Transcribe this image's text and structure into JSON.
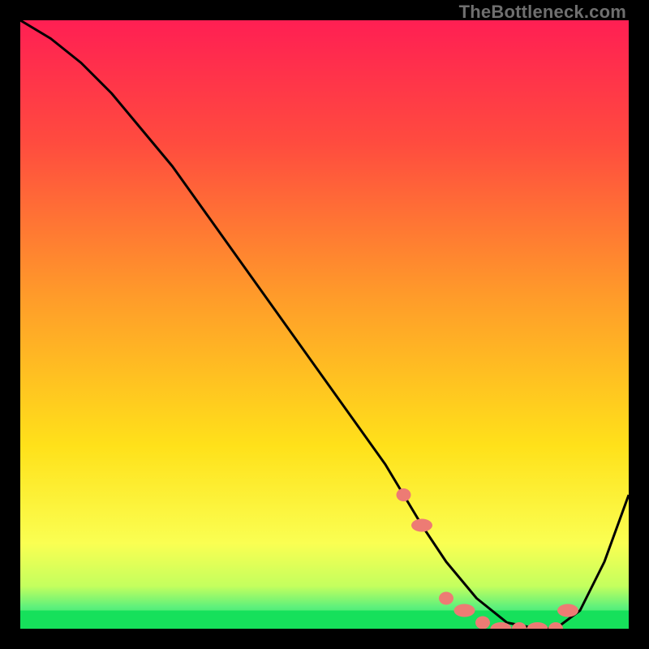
{
  "watermark": "TheBottleneck.com",
  "colors": {
    "curve": "#000000",
    "dots": "#ed7b74",
    "green_band": "#16e05b",
    "frame_bg": "#000000"
  },
  "chart_data": {
    "type": "line",
    "title": "",
    "xlabel": "",
    "ylabel": "",
    "xlim": [
      0,
      100
    ],
    "ylim": [
      0,
      100
    ],
    "grid": false,
    "legend": false,
    "series": [
      {
        "name": "bottleneck-curve",
        "x": [
          0,
          5,
          10,
          15,
          20,
          25,
          30,
          35,
          40,
          45,
          50,
          55,
          60,
          63,
          66,
          70,
          75,
          80,
          85,
          88,
          92,
          96,
          100
        ],
        "y": [
          100,
          97,
          93,
          88,
          82,
          76,
          69,
          62,
          55,
          48,
          41,
          34,
          27,
          22,
          17,
          11,
          5,
          1,
          0,
          0,
          3,
          11,
          22
        ]
      }
    ],
    "highlight_points": {
      "name": "optimal-range-dots",
      "x": [
        63,
        66,
        70,
        73,
        76,
        79,
        82,
        85,
        88,
        90
      ],
      "y": [
        22,
        17,
        5,
        3,
        1,
        0,
        0,
        0,
        0,
        3
      ]
    },
    "gradient_stops": [
      {
        "offset": 0.0,
        "color": "#ff1f53"
      },
      {
        "offset": 0.2,
        "color": "#ff4b3f"
      },
      {
        "offset": 0.45,
        "color": "#ff9a2a"
      },
      {
        "offset": 0.7,
        "color": "#ffe11a"
      },
      {
        "offset": 0.86,
        "color": "#faff52"
      },
      {
        "offset": 0.93,
        "color": "#c4ff5e"
      },
      {
        "offset": 0.965,
        "color": "#5cf07c"
      },
      {
        "offset": 1.0,
        "color": "#16e05b"
      }
    ]
  }
}
